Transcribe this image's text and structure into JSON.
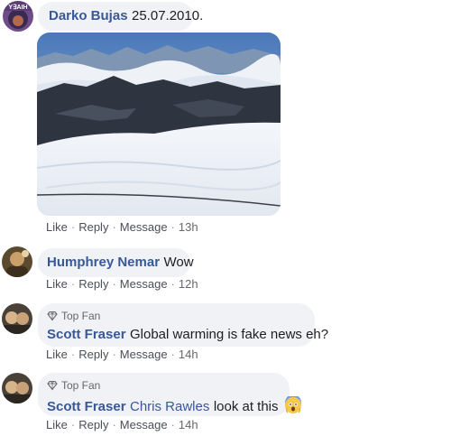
{
  "comments": [
    {
      "author": "Darko Bujas",
      "text": "25.07.2010.",
      "avatar_text": "Y∃AIH",
      "actions": {
        "like": "Like",
        "reply": "Reply",
        "message": "Message",
        "time": "13h"
      }
    },
    {
      "author": "Humphrey Nemar",
      "text": "Wow",
      "actions": {
        "like": "Like",
        "reply": "Reply",
        "message": "Message",
        "time": "12h"
      }
    },
    {
      "badge": "Top Fan",
      "author": "Scott Fraser",
      "text": "Global warming is fake news eh?",
      "actions": {
        "like": "Like",
        "reply": "Reply",
        "message": "Message",
        "time": "14h"
      }
    },
    {
      "badge": "Top Fan",
      "author": "Scott Fraser",
      "mention": "Chris Rawles",
      "text": "look at this",
      "actions": {
        "like": "Like",
        "reply": "Reply",
        "message": "Message",
        "time": "14h"
      }
    }
  ],
  "colors": {
    "author_link": "#385898",
    "bubble_bg": "#f0f2f5",
    "action_text": "#4b4f56"
  },
  "icons": {
    "badge": "diamond-icon",
    "emoji": "surprised-emoji-icon"
  }
}
